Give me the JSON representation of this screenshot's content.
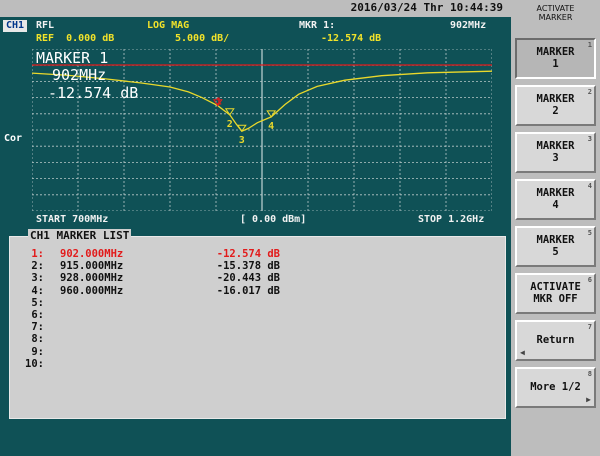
{
  "datetime": "2016/03/24 Thr 10:44:39",
  "channel_badge": "CH1",
  "header": {
    "measurement": "RFL",
    "format": "LOG MAG",
    "marker_label": "MKR 1:",
    "marker_freq": "902MHz",
    "ref": "REF  0.000 dB",
    "scale": "5.000 dB/",
    "marker_value": "-12.574 dB"
  },
  "plot_annotation": {
    "title": "MARKER 1",
    "freq": "902MHz",
    "value": "-12.574 dB"
  },
  "side_label": "Cor",
  "footer": {
    "start": "START 700MHz",
    "power": "[ 0.00 dBm]",
    "stop": "STOP 1.2GHz"
  },
  "marker_list": {
    "title": "CH1 MARKER LIST",
    "rows": [
      {
        "num": "1:",
        "freq": "902.000MHz",
        "value": "-12.574 dB",
        "active": true
      },
      {
        "num": "2:",
        "freq": "915.000MHz",
        "value": "-15.378 dB"
      },
      {
        "num": "3:",
        "freq": "928.000MHz",
        "value": "-20.443 dB"
      },
      {
        "num": "4:",
        "freq": "960.000MHz",
        "value": "-16.017 dB"
      },
      {
        "num": "5:",
        "freq": "",
        "value": ""
      },
      {
        "num": "6:",
        "freq": "",
        "value": ""
      },
      {
        "num": "7:",
        "freq": "",
        "value": ""
      },
      {
        "num": "8:",
        "freq": "",
        "value": ""
      },
      {
        "num": "9:",
        "freq": "",
        "value": ""
      },
      {
        "num": "10:",
        "freq": "",
        "value": ""
      }
    ]
  },
  "softkeys": {
    "title_line1": "ACTIVATE",
    "title_line2": "MARKER",
    "keys": [
      {
        "line1": "MARKER",
        "line2": "1",
        "key": "1"
      },
      {
        "line1": "MARKER",
        "line2": "2",
        "key": "2"
      },
      {
        "line1": "MARKER",
        "line2": "3",
        "key": "3"
      },
      {
        "line1": "MARKER",
        "line2": "4",
        "key": "4"
      },
      {
        "line1": "MARKER",
        "line2": "5",
        "key": "5"
      },
      {
        "line1": "ACTIVATE",
        "line2": "MKR OFF",
        "key": "6"
      },
      {
        "line1": "Return",
        "line2": "",
        "key": "7"
      },
      {
        "line1": "More 1/2",
        "line2": "",
        "key": "8"
      }
    ]
  },
  "trace_markers": [
    {
      "label": "1",
      "freq_mhz": 902,
      "value_db": -12.574
    },
    {
      "label": "2",
      "freq_mhz": 915,
      "value_db": -15.378
    },
    {
      "label": "3",
      "freq_mhz": 928,
      "value_db": -20.443
    },
    {
      "label": "4",
      "freq_mhz": 960,
      "value_db": -16.017
    }
  ],
  "colors": {
    "trace": "#e9d82b",
    "active_marker": "#e21b1b",
    "reference_line": "#e21b1b",
    "screen_bg": "#0f5156",
    "grid": "#b9c9c9"
  }
}
